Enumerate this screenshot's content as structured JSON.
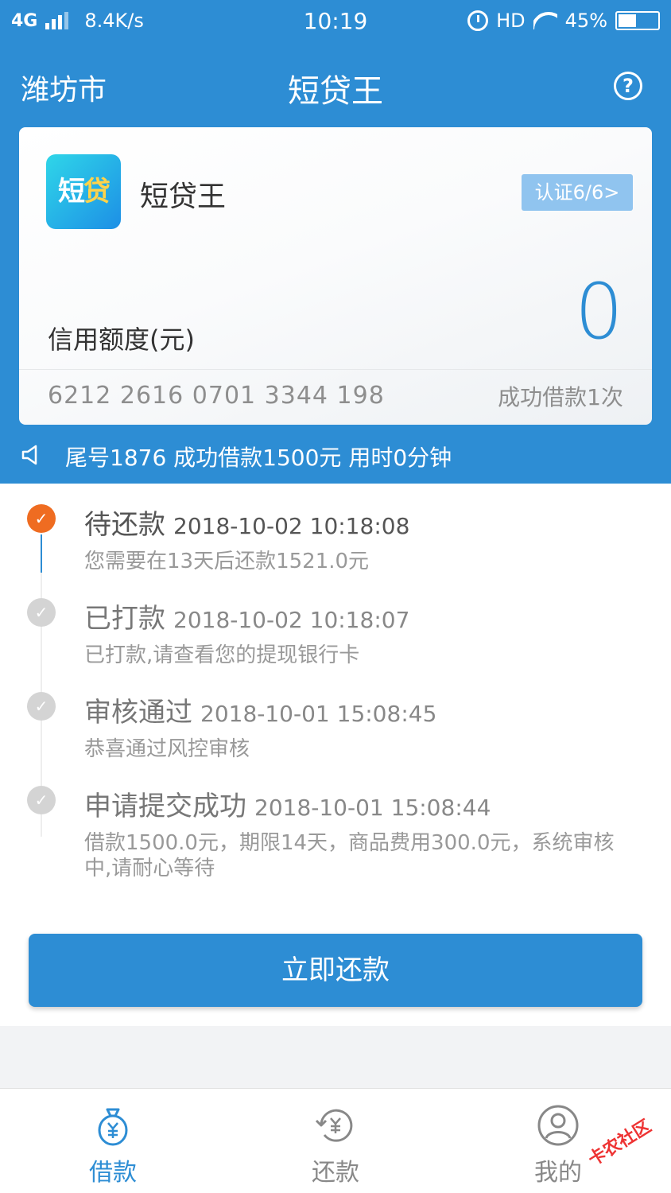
{
  "status_bar": {
    "network": "4G",
    "speed": "8.4K/s",
    "time": "10:19",
    "hd": "HD",
    "battery_percent": "45%",
    "battery_level": 0.45
  },
  "header": {
    "city": "潍坊市",
    "title": "短贷王",
    "help_symbol": "?"
  },
  "card": {
    "logo_text_1": "短",
    "logo_text_2": "贷",
    "app_name": "短贷王",
    "cert_label": "认证6/6>",
    "limit_label": "信用额度(元)",
    "limit_value": "0",
    "card_number": "6212 2616 0701 3344 198",
    "success_count": "成功借款1次"
  },
  "notice": {
    "text": "尾号1876 成功借款1500元 用时0分钟"
  },
  "timeline": [
    {
      "title": "待还款",
      "time": "2018-10-02 10:18:08",
      "desc": "您需要在13天后还款1521.0元",
      "active": true
    },
    {
      "title": "已打款",
      "time": "2018-10-02 10:18:07",
      "desc": "已打款,请查看您的提现银行卡",
      "active": false
    },
    {
      "title": "审核通过",
      "time": "2018-10-01 15:08:45",
      "desc": "恭喜通过风控审核",
      "active": false
    },
    {
      "title": "申请提交成功",
      "time": "2018-10-01 15:08:44",
      "desc": "借款1500.0元，期限14天，商品费用300.0元，系统审核中,请耐心等待",
      "active": false
    }
  ],
  "pay_button": "立即还款",
  "tabbar": {
    "items": [
      {
        "label": "借款",
        "icon": "money-bag-icon",
        "active": true
      },
      {
        "label": "还款",
        "icon": "refund-yuan-icon",
        "active": false
      },
      {
        "label": "我的",
        "icon": "user-icon",
        "active": false
      }
    ]
  },
  "watermark": "卡农社区",
  "colors": {
    "primary": "#2d8dd4",
    "accent": "#ef6c21",
    "inactive": "#888888"
  }
}
